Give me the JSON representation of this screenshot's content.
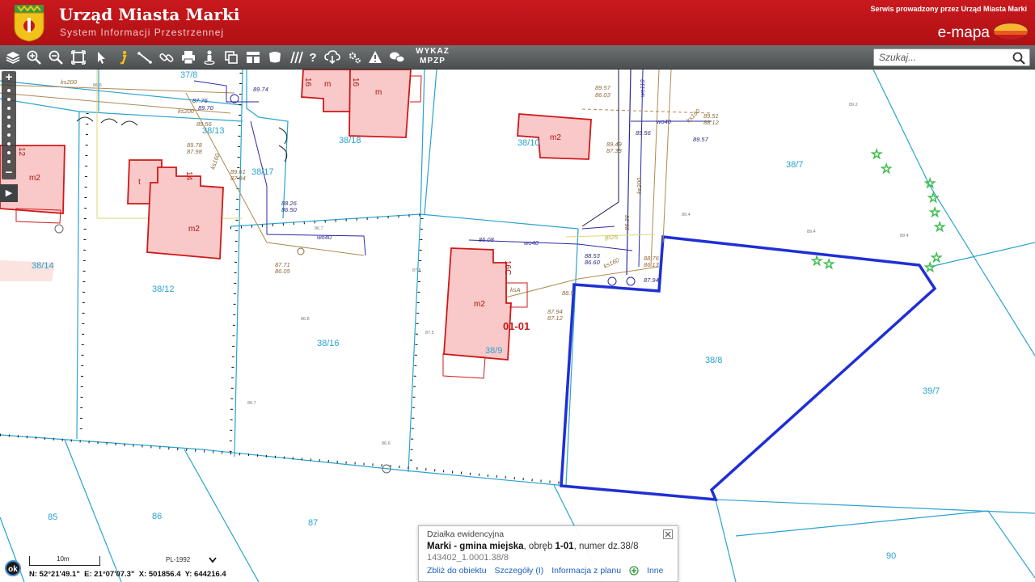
{
  "header": {
    "title": "Urząd Miasta Marki",
    "subtitle": "System Informacji Przestrzennej",
    "service_note": "Serwis prowadzony przez Urząd Miasta Marki",
    "brand": "e-mapa"
  },
  "toolbar": {
    "icons": [
      "layers-icon",
      "zoom-in-icon",
      "zoom-out-icon",
      "zoom-extent-icon",
      "select-arrow-icon",
      "info-icon",
      "measure-icon",
      "link-icon",
      "print-icon",
      "street-view-icon",
      "copy-icon",
      "table-icon",
      "area-icon",
      "hatch-icon",
      "help-icon",
      "cloud-download-icon",
      "settings-icon",
      "warning-icon",
      "comments-icon"
    ],
    "mpzp_line1": "WYKAZ",
    "mpzp_line2": "MPZP"
  },
  "search": {
    "placeholder": "Szukaj..."
  },
  "map": {
    "parcels": [
      {
        "label": "37/8"
      },
      {
        "label": "38/18"
      },
      {
        "label": "38/13"
      },
      {
        "label": "38/10"
      },
      {
        "label": "38/7"
      },
      {
        "label": "38/17"
      },
      {
        "label": "38/14"
      },
      {
        "label": "38/12"
      },
      {
        "label": "38/16"
      },
      {
        "label": "38/9"
      },
      {
        "label": "38/8"
      },
      {
        "label": "39/7"
      },
      {
        "label": "85"
      },
      {
        "label": "86"
      },
      {
        "label": "87"
      },
      {
        "label": "90"
      }
    ],
    "zone_label": "01-01",
    "building_labels": [
      "m2",
      "m2",
      "m2",
      "m2",
      "m2",
      "m",
      "m",
      "t"
    ],
    "building_numbers": [
      "16",
      "16",
      "14",
      "12",
      "16C"
    ],
    "utility_labels": [
      "ks200",
      "ks200",
      "ks160",
      "ks160",
      "ks200",
      "ks160",
      "wo40",
      "wo40",
      "wo40",
      "wo110",
      "gs25",
      "ksA"
    ],
    "elevations": [
      "89.74",
      "87.76",
      "89.70",
      "89.56",
      "89.78",
      "87.98",
      "89.61",
      "87.94",
      "88.26",
      "86.50",
      "87.71",
      "86.05",
      "89.57",
      "86.03",
      "89.56",
      "89.49",
      "87.38",
      "89.51",
      "88.12",
      "89.57",
      "86.08",
      "88.53",
      "86.60",
      "88.76",
      "86.13",
      "87.94",
      "87.94",
      "87.12",
      "88.9",
      "86.38"
    ],
    "spot_heights": [
      "86.6",
      "89.2",
      "89.4",
      "89.4",
      "86.8",
      "87.5",
      "87.5",
      "86.7",
      "86.6",
      "89.4",
      "86.7"
    ],
    "highlight_color": "#1f2fd6",
    "parcel_line_color": "#2aa3cf",
    "building_color": "#f9c9c9"
  },
  "popup": {
    "type": "Działka ewidencyjna",
    "place": "Marki - gmina miejska",
    "sep1": ", obręb ",
    "obreb": "1-01",
    "sep2": ", numer dz.",
    "parcel_no": "38/8",
    "id": "143402_1.0001.38/8",
    "link_zoom": "Zbliż do obiektu",
    "link_details": "Szczegóły (I)",
    "link_plan": "Informacja z planu",
    "link_other": "Inne"
  },
  "footer": {
    "ok_label": "ok",
    "scale": "10m",
    "crs": "PL-1992",
    "coord_n": "N: 52°21'49.1\"",
    "coord_e": "E: 21°07'07.3\"",
    "coord_x": "X: 501856.4",
    "coord_y": "Y: 644216.4"
  }
}
